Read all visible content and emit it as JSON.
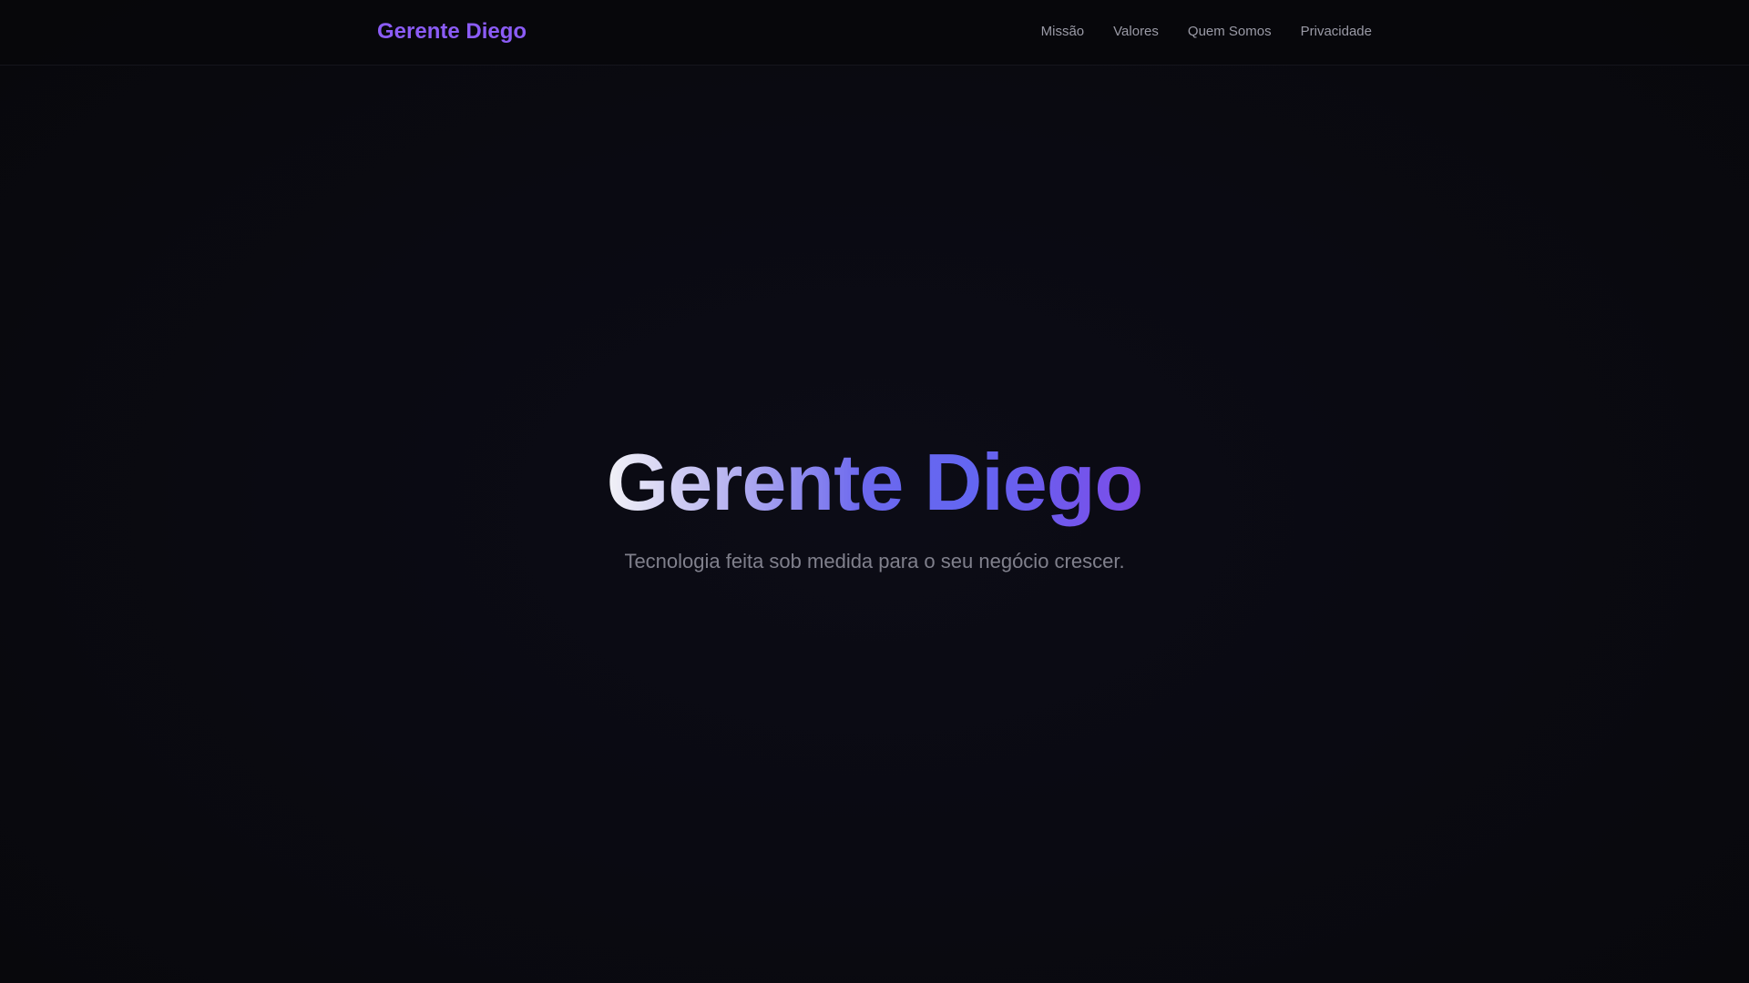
{
  "header": {
    "brand": "Gerente Diego",
    "nav": [
      {
        "label": "Missão"
      },
      {
        "label": "Valores"
      },
      {
        "label": "Quem Somos"
      },
      {
        "label": "Privacidade"
      }
    ]
  },
  "hero": {
    "title": "Gerente Diego",
    "subtitle": "Tecnologia feita sob medida para o seu negócio crescer."
  },
  "colors": {
    "background": "#08080b",
    "brand": "#8b5cf6",
    "nav_text": "#9a9aa6",
    "subtitle_text": "#80808c",
    "title_gradient": [
      "#f2f2f7",
      "#6366f1",
      "#7c4ce8"
    ]
  }
}
